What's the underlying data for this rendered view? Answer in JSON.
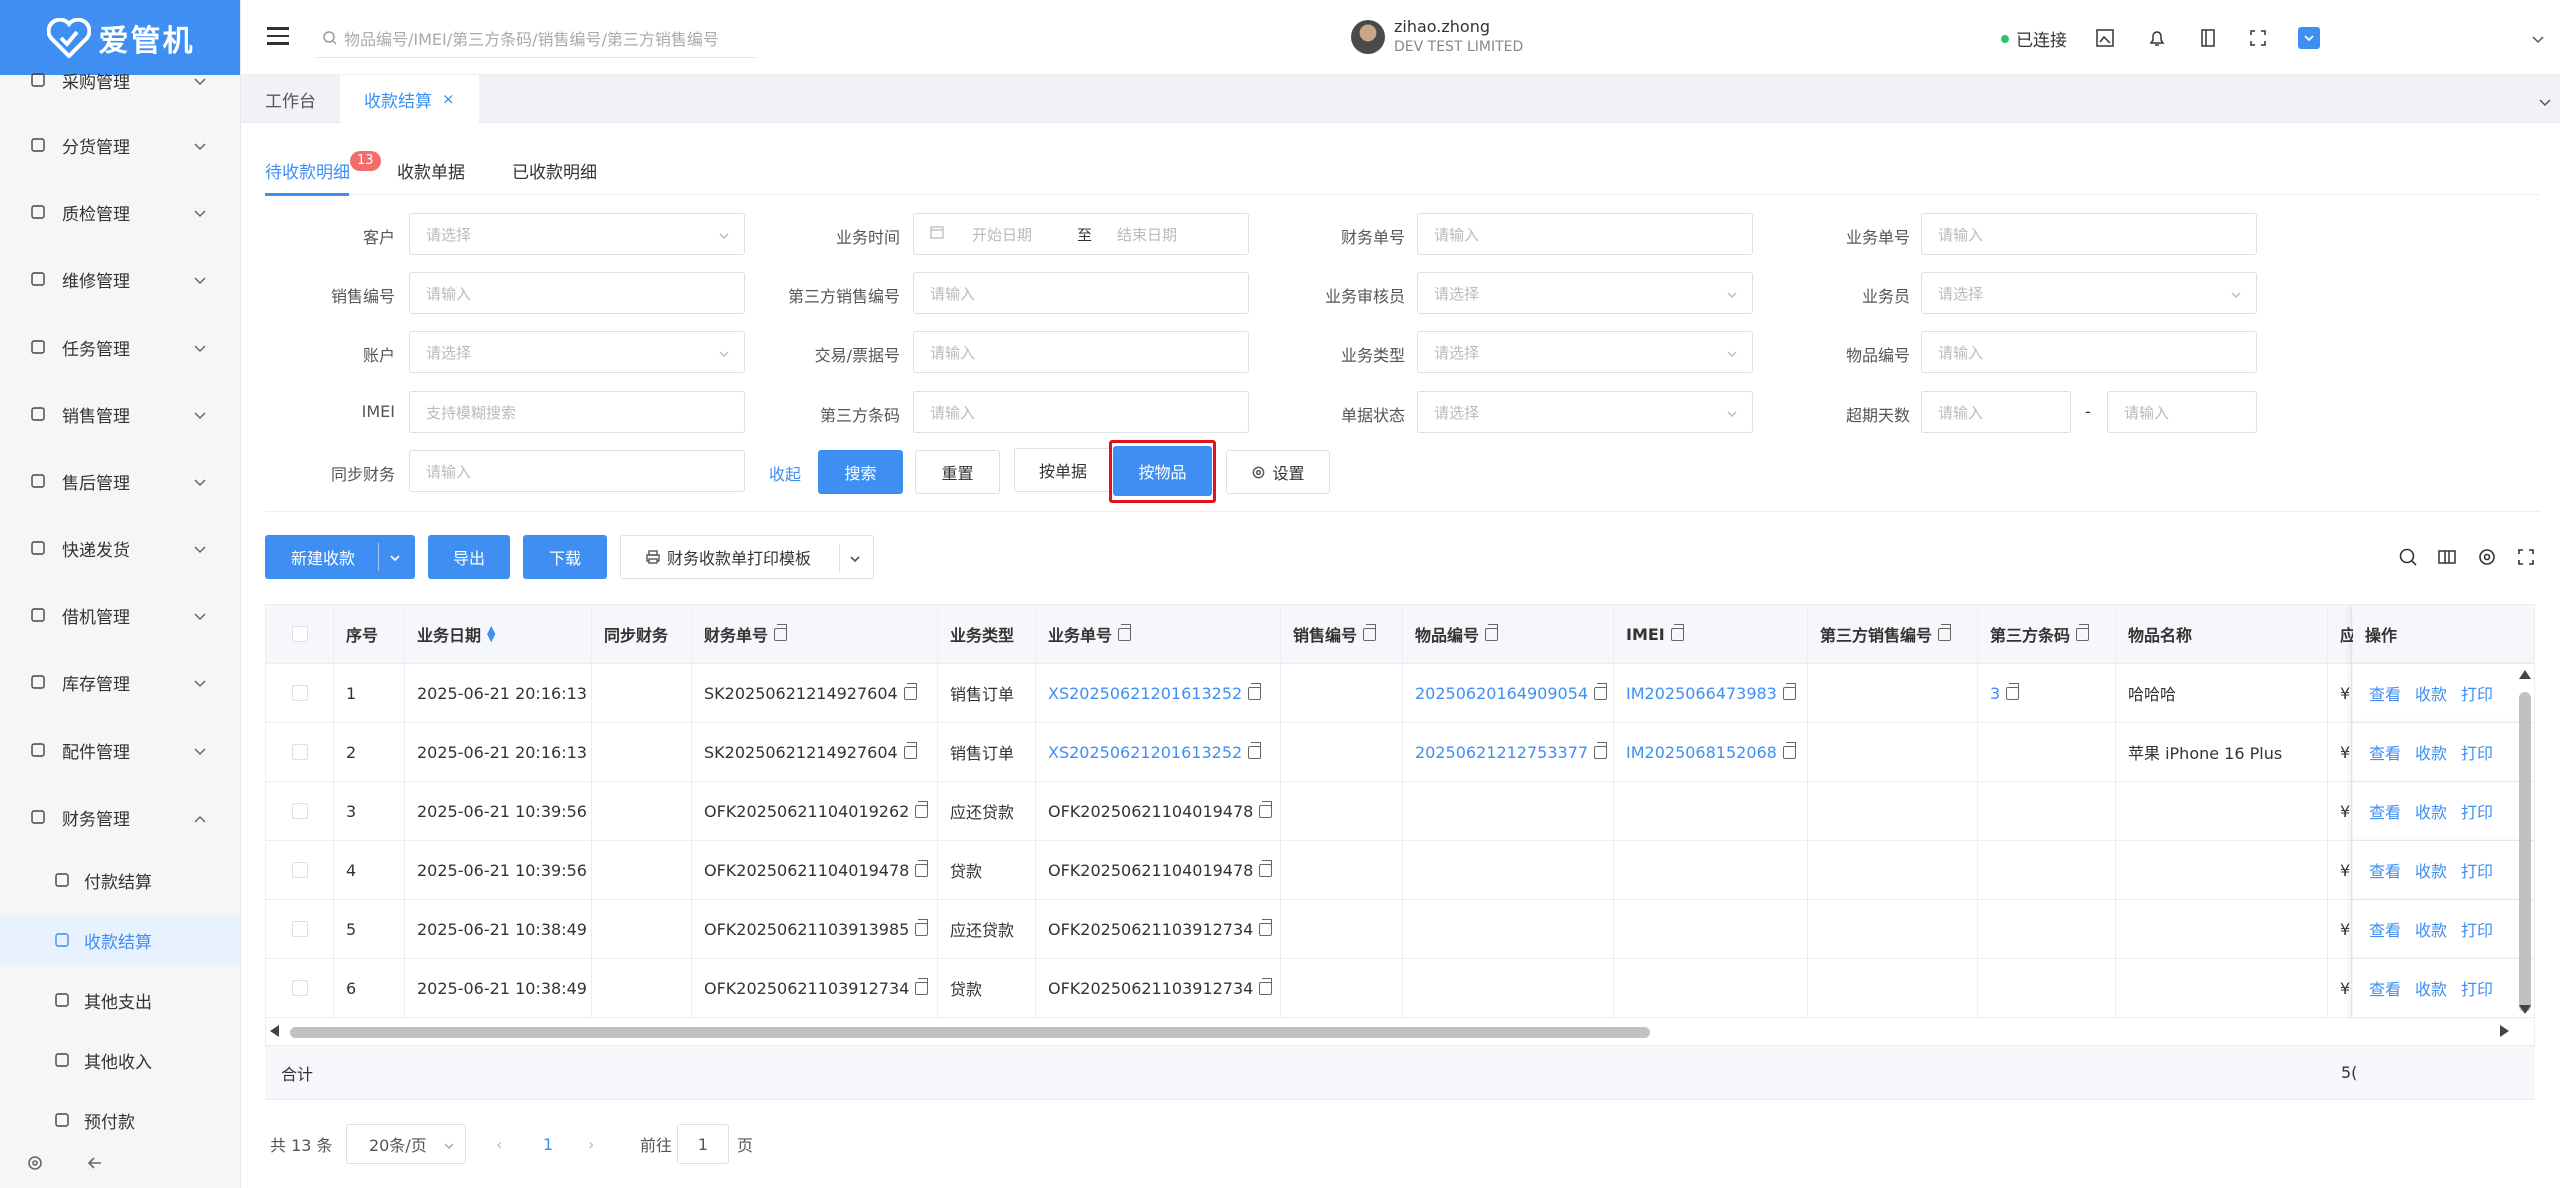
{
  "app": {
    "logo_text": "爱管机",
    "brand_color": "#3f8ff3"
  },
  "search": {
    "placeholder": "物品编号/IMEI/第三方条码/销售编号/第三方销售编号"
  },
  "header": {
    "connection_status": "已连接",
    "user_name": "zihao.zhong",
    "company": "DEV TEST LIMITED"
  },
  "sidebar": {
    "items": [
      {
        "label": "采购管理",
        "icon": "cart-icon"
      },
      {
        "label": "分货管理",
        "icon": "list-icon"
      },
      {
        "label": "质检管理",
        "icon": "shield-icon"
      },
      {
        "label": "维修管理",
        "icon": "wrench-icon"
      },
      {
        "label": "任务管理",
        "icon": "task-icon"
      },
      {
        "label": "销售管理",
        "icon": "box-icon"
      },
      {
        "label": "售后管理",
        "icon": "service-icon"
      },
      {
        "label": "快递发货",
        "icon": "truck-icon"
      },
      {
        "label": "借机管理",
        "icon": "phone-icon"
      },
      {
        "label": "库存管理",
        "icon": "warehouse-icon"
      },
      {
        "label": "配件管理",
        "icon": "parts-icon"
      },
      {
        "label": "财务管理",
        "icon": "yen-icon"
      }
    ],
    "sub_items": [
      {
        "label": "付款结算"
      },
      {
        "label": "收款结算"
      },
      {
        "label": "其他支出"
      },
      {
        "label": "其他收入"
      },
      {
        "label": "预付款"
      }
    ]
  },
  "tabs": {
    "workbench": "工作台",
    "current": "收款结算"
  },
  "subtabs": {
    "pending": "待收款明细",
    "pending_count": "13",
    "receipts": "收款单据",
    "received": "已收款明细"
  },
  "filters": {
    "customer": {
      "label": "客户",
      "placeholder": "请选择"
    },
    "biz_time": {
      "label": "业务时间",
      "start": "开始日期",
      "sep": "至",
      "end": "结束日期"
    },
    "finance_no": {
      "label": "财务单号",
      "placeholder": "请输入"
    },
    "biz_no": {
      "label": "业务单号",
      "placeholder": "请输入"
    },
    "sales_no": {
      "label": "销售编号",
      "placeholder": "请输入"
    },
    "third_sales_no": {
      "label": "第三方销售编号",
      "placeholder": "请输入"
    },
    "reviewer": {
      "label": "业务审核员",
      "placeholder": "请选择"
    },
    "salesman": {
      "label": "业务员",
      "placeholder": "请选择"
    },
    "account": {
      "label": "账户",
      "placeholder": "请选择"
    },
    "trade_no": {
      "label": "交易/票据号",
      "placeholder": "请输入"
    },
    "biz_type": {
      "label": "业务类型",
      "placeholder": "请选择"
    },
    "item_no": {
      "label": "物品编号",
      "placeholder": "请输入"
    },
    "imei": {
      "label": "IMEI",
      "placeholder": "支持模糊搜索"
    },
    "third_barcode": {
      "label": "第三方条码",
      "placeholder": "请输入"
    },
    "doc_status": {
      "label": "单据状态",
      "placeholder": "请选择"
    },
    "overdue": {
      "label": "超期天数",
      "placeholder_a": "请输入",
      "sep": "-",
      "placeholder_b": "请输入"
    },
    "sync": {
      "label": "同步财务",
      "placeholder": "请输入"
    }
  },
  "actions": {
    "collapse": "收起",
    "search": "搜索",
    "reset": "重置",
    "by_doc": "按单据",
    "by_item": "按物品",
    "settings": "设置"
  },
  "toolbar": {
    "new": "新建收款",
    "export": "导出",
    "download": "下载",
    "print_tpl": "财务收款单打印模板"
  },
  "table": {
    "headers": [
      "序号",
      "业务日期",
      "同步财务",
      "财务单号",
      "业务类型",
      "业务单号",
      "销售编号",
      "物品编号",
      "IMEI",
      "第三方销售编号",
      "第三方条码",
      "物品名称",
      "应",
      "操作"
    ],
    "rows": [
      {
        "idx": "1",
        "date": "2025-06-21 20:16:13",
        "sync": "",
        "fin": "SK20250621214927604",
        "type": "销售订单",
        "biz": "XS20250621201613252",
        "sales": "",
        "item": "20250620164909054",
        "imei": "IM2025066473983",
        "tsales": "",
        "tbar": "3",
        "name": "哈哈哈",
        "amt": "¥"
      },
      {
        "idx": "2",
        "date": "2025-06-21 20:16:13",
        "sync": "",
        "fin": "SK20250621214927604",
        "type": "销售订单",
        "biz": "XS20250621201613252",
        "sales": "",
        "item": "20250621212753377",
        "imei": "IM2025068152068",
        "tsales": "",
        "tbar": "",
        "name": "苹果 iPhone 16 Plus",
        "amt": "¥"
      },
      {
        "idx": "3",
        "date": "2025-06-21 10:39:56",
        "sync": "",
        "fin": "OFK20250621104019262",
        "type": "应还贷款",
        "biz": "OFK20250621104019478",
        "sales": "",
        "item": "",
        "imei": "",
        "tsales": "",
        "tbar": "",
        "name": "",
        "amt": "¥"
      },
      {
        "idx": "4",
        "date": "2025-06-21 10:39:56",
        "sync": "",
        "fin": "OFK20250621104019478",
        "type": "贷款",
        "biz": "OFK20250621104019478",
        "sales": "",
        "item": "",
        "imei": "",
        "tsales": "",
        "tbar": "",
        "name": "",
        "amt": "¥"
      },
      {
        "idx": "5",
        "date": "2025-06-21 10:38:49",
        "sync": "",
        "fin": "OFK20250621103913985",
        "type": "应还贷款",
        "biz": "OFK20250621103912734",
        "sales": "",
        "item": "",
        "imei": "",
        "tsales": "",
        "tbar": "",
        "name": "",
        "amt": "¥"
      },
      {
        "idx": "6",
        "date": "2025-06-21 10:38:49",
        "sync": "",
        "fin": "OFK20250621103912734",
        "type": "贷款",
        "biz": "OFK20250621103912734",
        "sales": "",
        "item": "",
        "imei": "",
        "tsales": "",
        "tbar": "",
        "name": "",
        "amt": "¥"
      }
    ],
    "ops": {
      "view": "查看",
      "collect": "收款",
      "print": "打印"
    },
    "sum_label": "合计",
    "sum_value": "5("
  },
  "pager": {
    "total": "共 13 条",
    "page_size": "20条/页",
    "current": "1",
    "goto": "前往",
    "goto_value": "1",
    "page_unit": "页"
  }
}
